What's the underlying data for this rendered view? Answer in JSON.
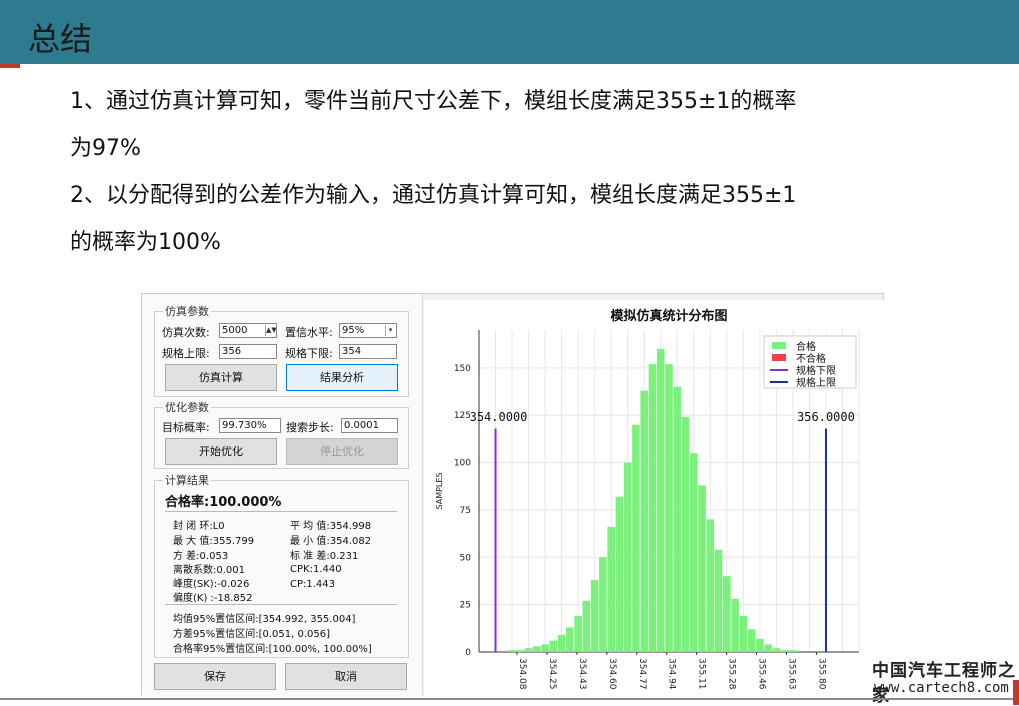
{
  "slide": {
    "title": "总结",
    "lines": [
      "1、通过仿真计算可知，零件当前尺寸公差下，模组长度满足355±1的概率",
      "为97%",
      "2、以分配得到的公差作为输入，通过仿真计算可知，模组长度满足355±1",
      "的概率为100%"
    ],
    "watermark_cn": "中国汽车工程师之家",
    "watermark_url": "www.cartech8.com"
  },
  "sim_params": {
    "group_title": "仿真参数",
    "count_label": "仿真次数:",
    "count_value": "5000",
    "confidence_label": "置信水平:",
    "confidence_value": "95%",
    "upper_label": "规格上限:",
    "upper_value": "356",
    "lower_label": "规格下限:",
    "lower_value": "354",
    "simulate_button": "仿真计算",
    "analyze_button": "结果分析"
  },
  "opt_params": {
    "group_title": "优化参数",
    "target_label": "目标概率:",
    "target_value": "99.730%",
    "step_label": "搜索步长:",
    "step_value": "0.0001",
    "start_button": "开始优化",
    "stop_button": "停止优化"
  },
  "results": {
    "group_title": "计算结果",
    "pass_rate": "合格率:100.000%",
    "left": [
      "封 闭 环:L0",
      "最 大 值:355.799",
      "方    差:0.053",
      "离散系数:0.001",
      "峰度(SK):-0.026",
      "偏度(K) :-18.852"
    ],
    "right": [
      "平 均 值:354.998",
      "最 小 值:354.082",
      "标 准 差:0.231",
      "CPK:1.440",
      "CP:1.443"
    ],
    "intervals": [
      "均值95%置信区间:[354.992, 355.004]",
      "方差95%置信区间:[0.051, 0.056]",
      "合格率95%置信区间:[100.00%, 100.00%]"
    ],
    "save_button": "保存",
    "cancel_button": "取消"
  },
  "chart_data": {
    "type": "bar",
    "title": "模拟仿真统计分布图",
    "ylabel": "SAMPLES",
    "xlabel": "",
    "ylim": [
      0,
      170
    ],
    "yticks": [
      0,
      25,
      50,
      75,
      100,
      125,
      150
    ],
    "xlim": [
      353.9,
      356.2
    ],
    "xticks": [
      "354.08",
      "354.25",
      "354.43",
      "354.60",
      "354.77",
      "354.94",
      "355.11",
      "355.28",
      "355.46",
      "355.63",
      "355.80"
    ],
    "grid": true,
    "legend_position": "top-right",
    "legend": [
      "合格",
      "不合格",
      "规格下限",
      "规格上限"
    ],
    "colors": {
      "pass": "#7cf07c",
      "fail": "#ee4444",
      "lower": "#8a2be2",
      "upper": "#1a2ea8"
    },
    "spec_lower": 354.0,
    "spec_upper": 356.0,
    "spec_lower_label": "354.0000",
    "spec_upper_label": "356.0000",
    "bins": {
      "x": [
        354.1,
        354.15,
        354.2,
        354.25,
        354.3,
        354.35,
        354.4,
        354.45,
        354.5,
        354.55,
        354.6,
        354.65,
        354.7,
        354.75,
        354.8,
        354.85,
        354.9,
        354.95,
        355.0,
        355.05,
        355.1,
        355.15,
        355.2,
        355.25,
        355.3,
        355.35,
        355.4,
        355.45,
        355.5,
        355.55,
        355.6,
        355.65,
        355.7,
        355.75,
        355.8
      ],
      "values": [
        1,
        1,
        2,
        3,
        4,
        6,
        9,
        13,
        19,
        27,
        38,
        50,
        66,
        82,
        100,
        120,
        138,
        152,
        160,
        152,
        140,
        124,
        105,
        88,
        70,
        54,
        40,
        28,
        19,
        12,
        7,
        4,
        2,
        1,
        1
      ]
    }
  }
}
